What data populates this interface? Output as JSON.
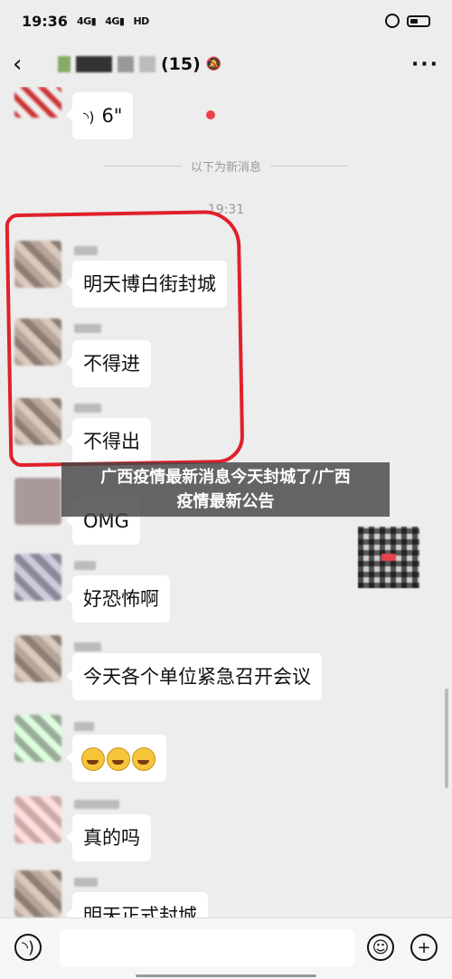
{
  "status_bar": {
    "time": "19:36",
    "network_1": "4G",
    "network_2": "4G",
    "hd": "HD"
  },
  "nav": {
    "back_glyph": "‹",
    "member_count": "(15)",
    "more_glyph": "···"
  },
  "chat": {
    "voice_duration": "6\"",
    "divider_label": "以下为新消息",
    "timestamp": "19:31",
    "messages": [
      {
        "text": "明天博白街封城"
      },
      {
        "text": "不得进"
      },
      {
        "text": "不得出"
      },
      {
        "text": "OMG"
      },
      {
        "text": "好恐怖啊"
      },
      {
        "text": "今天各个单位紧急召开会议"
      },
      {
        "text": "真的吗"
      },
      {
        "text": "明天正式封城"
      }
    ]
  },
  "overlay": {
    "line1": "广西疫情最新消息今天封城了/广西",
    "line2": "疫情最新公告"
  },
  "colors": {
    "accent_red": "#e0202a",
    "unread": "#e8434b"
  }
}
